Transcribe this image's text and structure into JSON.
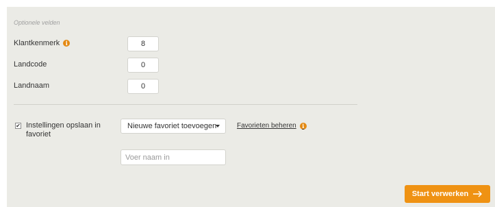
{
  "section": {
    "title": "Optionele velden"
  },
  "fields": [
    {
      "label": "Klantkenmerk",
      "value": "8",
      "has_info": true
    },
    {
      "label": "Landcode",
      "value": "0",
      "has_info": false
    },
    {
      "label": "Landnaam",
      "value": "0",
      "has_info": false
    }
  ],
  "favorites": {
    "save_label": "Instellingen opslaan in favoriet",
    "save_checked": true,
    "select_value": "Nieuwe favoriet toevoegen",
    "manage_link": "Favorieten beheren",
    "name_placeholder": "Voer naam in",
    "name_value": ""
  },
  "actions": {
    "start_label": "Start verwerken"
  },
  "icons": {
    "info": "info-icon",
    "checkbox": "checkmark-icon",
    "caret": "chevron-down-icon",
    "arrow": "arrow-right-icon"
  },
  "colors": {
    "accent": "#ef9213",
    "panel": "#ebebe6",
    "info": "#e48a14"
  }
}
